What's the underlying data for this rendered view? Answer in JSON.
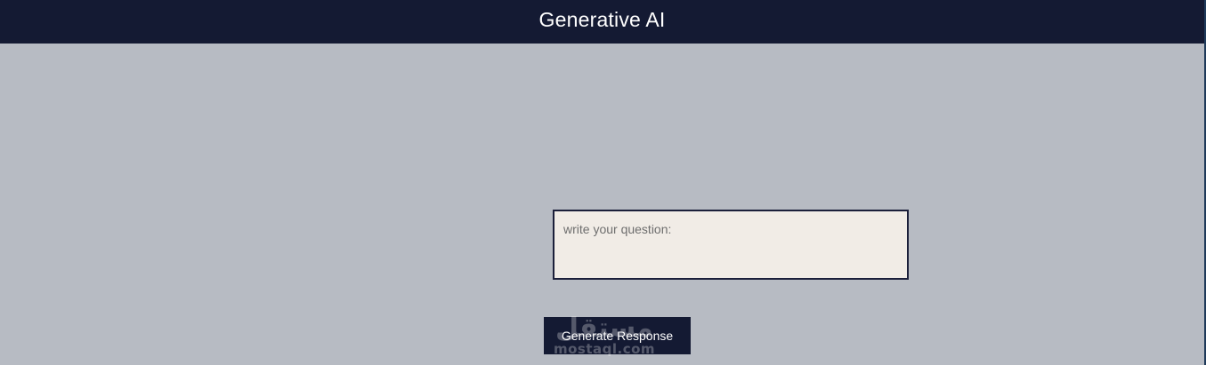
{
  "header": {
    "title": "Generative AI"
  },
  "question": {
    "placeholder": "write your question:",
    "value": ""
  },
  "actions": {
    "generate_label": "Generate Response"
  },
  "watermark": {
    "arabic": "مستقل",
    "latin": "mostaql.com"
  },
  "colors": {
    "header_bg": "#141a33",
    "page_bg": "#b7bbc3",
    "input_bg": "#f1ece6",
    "button_bg": "#141a33",
    "text_light": "#ffffff"
  }
}
